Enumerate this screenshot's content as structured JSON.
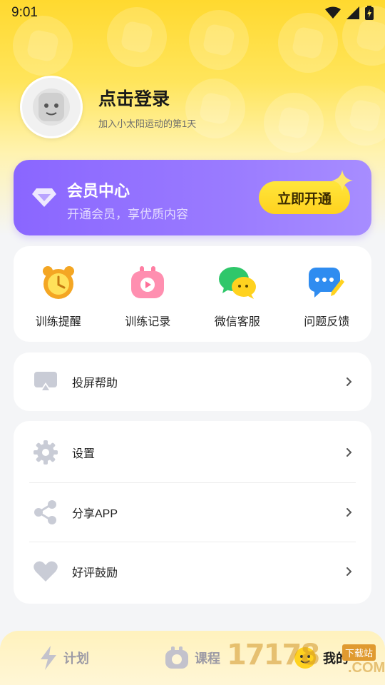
{
  "status_bar": {
    "time": "9:01"
  },
  "profile": {
    "title": "点击登录",
    "subtitle": "加入小太阳运动的第1天"
  },
  "vip": {
    "title": "会员中心",
    "subtitle": "开通会员，享优质内容",
    "button": "立即开通",
    "color": "#8a66ff"
  },
  "quick_actions": [
    {
      "label": "训练提醒",
      "icon": "alarm-clock-icon"
    },
    {
      "label": "训练记录",
      "icon": "tv-play-icon"
    },
    {
      "label": "微信客服",
      "icon": "wechat-icon"
    },
    {
      "label": "问题反馈",
      "icon": "chat-edit-icon"
    }
  ],
  "cast_help": {
    "label": "投屏帮助",
    "icon": "screen-cast-icon"
  },
  "settings_menu": [
    {
      "label": "设置",
      "icon": "gear-icon"
    },
    {
      "label": "分享APP",
      "icon": "share-icon"
    },
    {
      "label": "好评鼓励",
      "icon": "heart-icon"
    }
  ],
  "tabbar": {
    "tabs": [
      {
        "label": "计划",
        "icon": "lightning-icon"
      },
      {
        "label": "课程",
        "icon": "tv-play-icon"
      },
      {
        "label": "我的",
        "icon": "face-icon",
        "active": true
      }
    ]
  },
  "watermark": {
    "number": "17178",
    "tag": "下载站",
    "suffix": ".COM"
  }
}
